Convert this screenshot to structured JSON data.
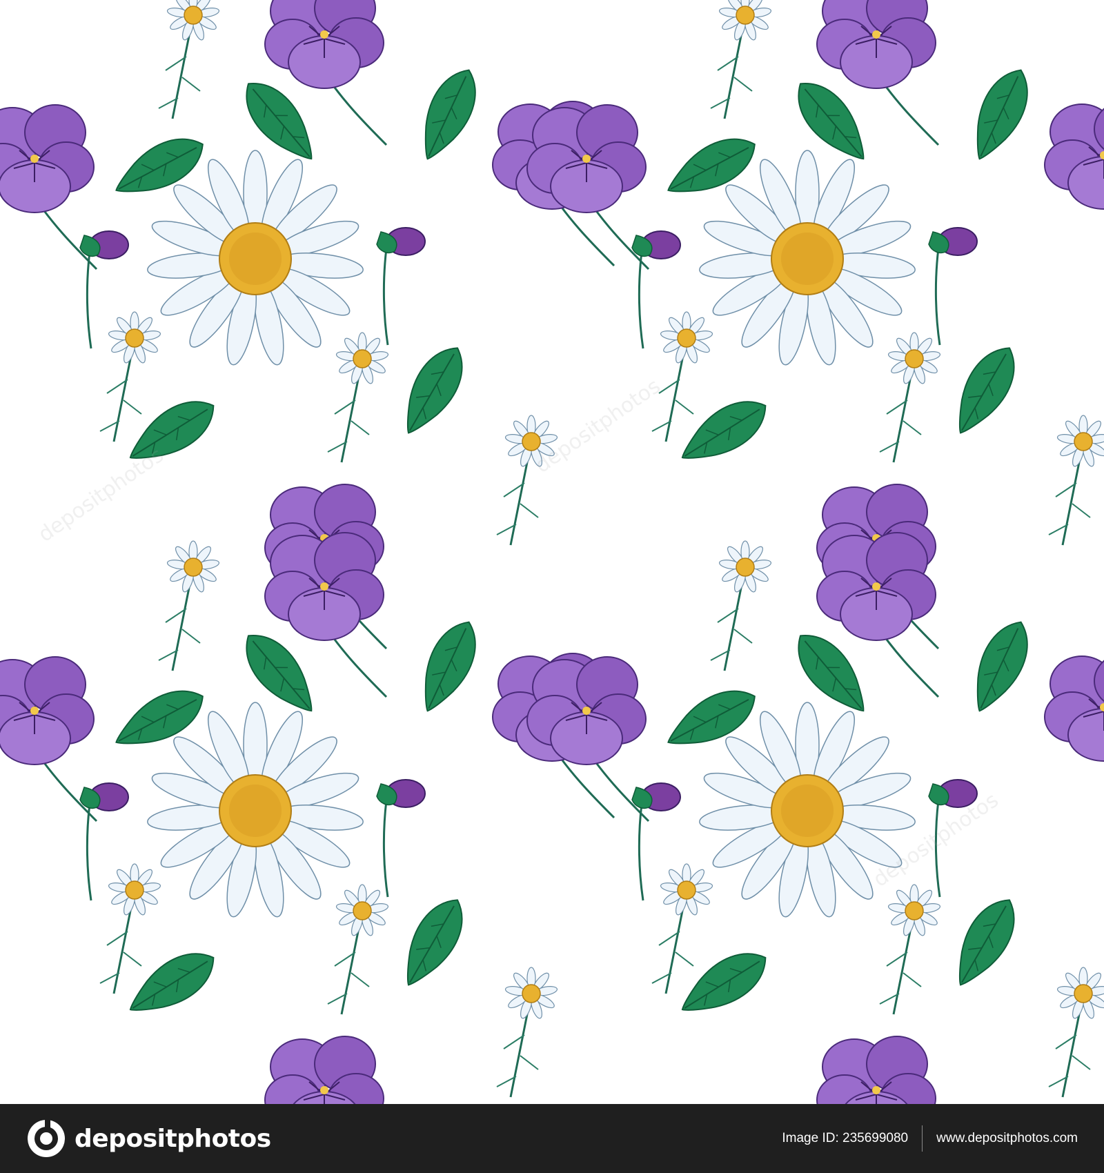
{
  "colors": {
    "background": "#ffffff",
    "footer": "#1f1f1f",
    "leaf": "#1f8a55",
    "leaf_dark": "#0f5c38",
    "pansy": "#8d5cbf",
    "pansy_dark": "#4a2a7a",
    "daisy_center": "#e8b12f",
    "daisy_petal": "#eef5fb"
  },
  "pattern": {
    "motifs": [
      "large-daisy",
      "purple-pansy",
      "green-leaf",
      "chamomile-sprig",
      "pansy-bud"
    ]
  },
  "footer": {
    "brand": "depositphotos",
    "image_id": "Image ID: 235699080",
    "site": "www.depositphotos.com"
  },
  "watermark": {
    "text": "depositphotos"
  }
}
